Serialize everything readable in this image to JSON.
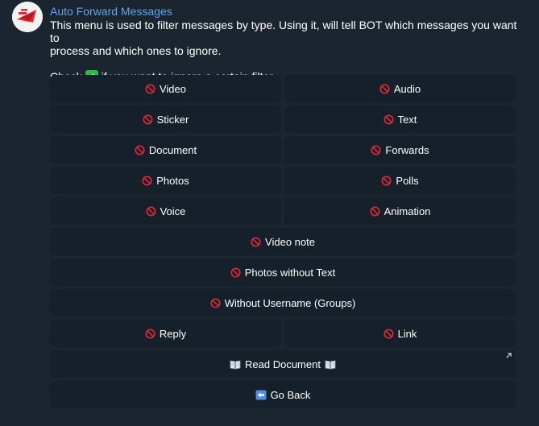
{
  "sender": {
    "name": "Auto Forward Messages",
    "name_color": "#5fa8ea"
  },
  "message": {
    "line1": "This menu is used to filter messages by type. Using it, will tell BOT which messages you want to",
    "line2": "process and which ones to ignore.",
    "check_prefix": "Check",
    "check_suffix": "if you want to ignore a certain filter.",
    "check_icon": "white-check-mark-icon"
  },
  "buttons": {
    "video": "Video",
    "audio": "Audio",
    "sticker": "Sticker",
    "text": "Text",
    "document": "Document",
    "forwards": "Forwards",
    "photos": "Photos",
    "polls": "Polls",
    "voice": "Voice",
    "animation": "Animation",
    "video_note": "Video note",
    "photos_without_text": "Photos without Text",
    "without_username": "Without Username (Groups)",
    "reply": "Reply",
    "link": "Link",
    "read_document": "Read Document",
    "go_back": "Go Back"
  },
  "icons": {
    "filter_state": "no-entry-icon",
    "read_document": "open-book-icon",
    "go_back": "back-arrow-icon",
    "url_button": "external-link-arrow-icon"
  },
  "colors": {
    "background": "#1b2530",
    "button_bg": "#16202a",
    "no_entry": "#e0283a",
    "check_green": "#2fb84a"
  }
}
